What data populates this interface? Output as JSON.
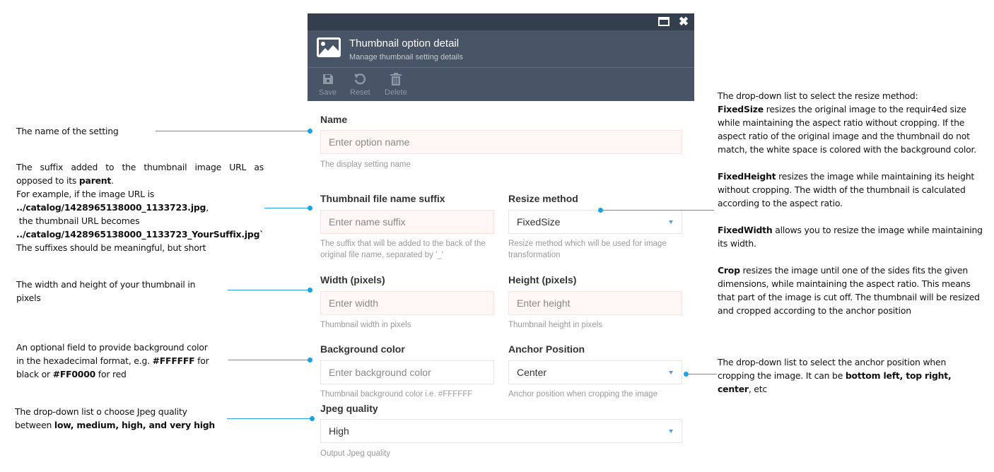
{
  "window": {
    "maximize_icon": "maximize-icon",
    "close_icon": "close-icon",
    "close_glyph": "✖"
  },
  "header": {
    "icon": "image-icon",
    "title": "Thumbnail option detail",
    "subtitle": "Manage thumbnail setting details"
  },
  "toolbar": {
    "save_label": "Save",
    "reset_label": "Reset",
    "delete_label": "Delete"
  },
  "form": {
    "name": {
      "label": "Name",
      "placeholder": "Enter option name",
      "value": "",
      "hint": "The display setting name"
    },
    "suffix": {
      "label": "Thumbnail file name suffix",
      "placeholder": "Enter name suffix",
      "value": "",
      "hint": "The suffix that will be added to the back of the original file name, separated by '_'"
    },
    "resize_method": {
      "label": "Resize method",
      "selected": "FixedSize",
      "hint": "Resize method which will be used for image transformation"
    },
    "width": {
      "label": "Width (pixels)",
      "placeholder": "Enter width",
      "value": "",
      "hint": "Thumbnail width in pixels"
    },
    "height": {
      "label": "Height (pixels)",
      "placeholder": "Enter height",
      "value": "",
      "hint": "Thumbnail height in pixels"
    },
    "background_color": {
      "label": "Background color",
      "placeholder": "Enter background color",
      "value": "",
      "hint": "Thumbnail background color i.e. #FFFFFF"
    },
    "anchor_position": {
      "label": "Anchor Position",
      "selected": "Center",
      "hint": "Anchor position when cropping the image"
    },
    "jpeg_quality": {
      "label": "Jpeg quality",
      "selected": "High",
      "hint": "Output Jpeg quality"
    }
  },
  "annotations": {
    "name": "The name of the setting",
    "suffix": {
      "line1": "The suffix added to the thumbnail image URL as",
      "line2_pre": "opposed to its ",
      "line2_bold": "parent",
      "line2_post": ".",
      "line3": "For example, if the image URL is",
      "line4_bold": "../catalog/1428965138000_1133723.jpg",
      "line4_post": ",",
      "line5": " the thumbnail URL becomes",
      "line6_bold": "../catalog/1428965138000_1133723_YourSuffix.jpg`",
      "line7": "The suffixes should be meaningful, but short"
    },
    "dimensions": "The width and height of your thumbnail in pixels",
    "background": {
      "line1": "An optional field to provide background color",
      "line2_pre": "in the hexadecimal format, e.g. ",
      "line2_bold": "#FFFFFF",
      "line2_post": " for",
      "line3_pre": "black or ",
      "line3_bold": "#FF0000",
      "line3_post": " for red"
    },
    "jpeg": {
      "line1": "The drop-down list o choose Jpeg quality",
      "line2_pre": "between ",
      "line2_bold": "low, medium, high, and very high"
    },
    "resize": {
      "intro": "The drop-down list to select the resize method:",
      "fixedsize_bold": "FixedSize",
      "fixedsize_text": " resizes the original image to the requir4ed size while maintaining the aspect ratio without cropping. If the aspect ratio of the original image and the thumbnail do not match, the white space is colored with the background color.",
      "fixedheight_bold": "FixedHeight",
      "fixedheight_text": " resizes the image while maintaining its height without cropping. The width of the thumbnail is calculated according to the aspect ratio.",
      "fixedwidth_bold": "FixedWidth",
      "fixedwidth_text": " allows you to resize the image while maintaining its width.",
      "crop_bold": "Crop",
      "crop_text": " resizes the image until one of the sides fits the given dimensions, while maintaining the aspect ratio. This means that part of the image is cut off. The thumbnail will be resized and cropped according to the anchor position"
    },
    "anchor": {
      "line1": "The drop-down list to select the anchor position when",
      "line2_pre": "cropping the image. It can be ",
      "line2_bold": "bottom left, top right,",
      "line3_bold": "center",
      "line3_post": ", etc"
    }
  },
  "colors": {
    "titlebar": "#333f4d",
    "header": "#475566",
    "connector": "#27a6e0",
    "error_bg": "#fff7f6",
    "error_border": "#fde2e0",
    "caret": "#5b9bd5"
  }
}
